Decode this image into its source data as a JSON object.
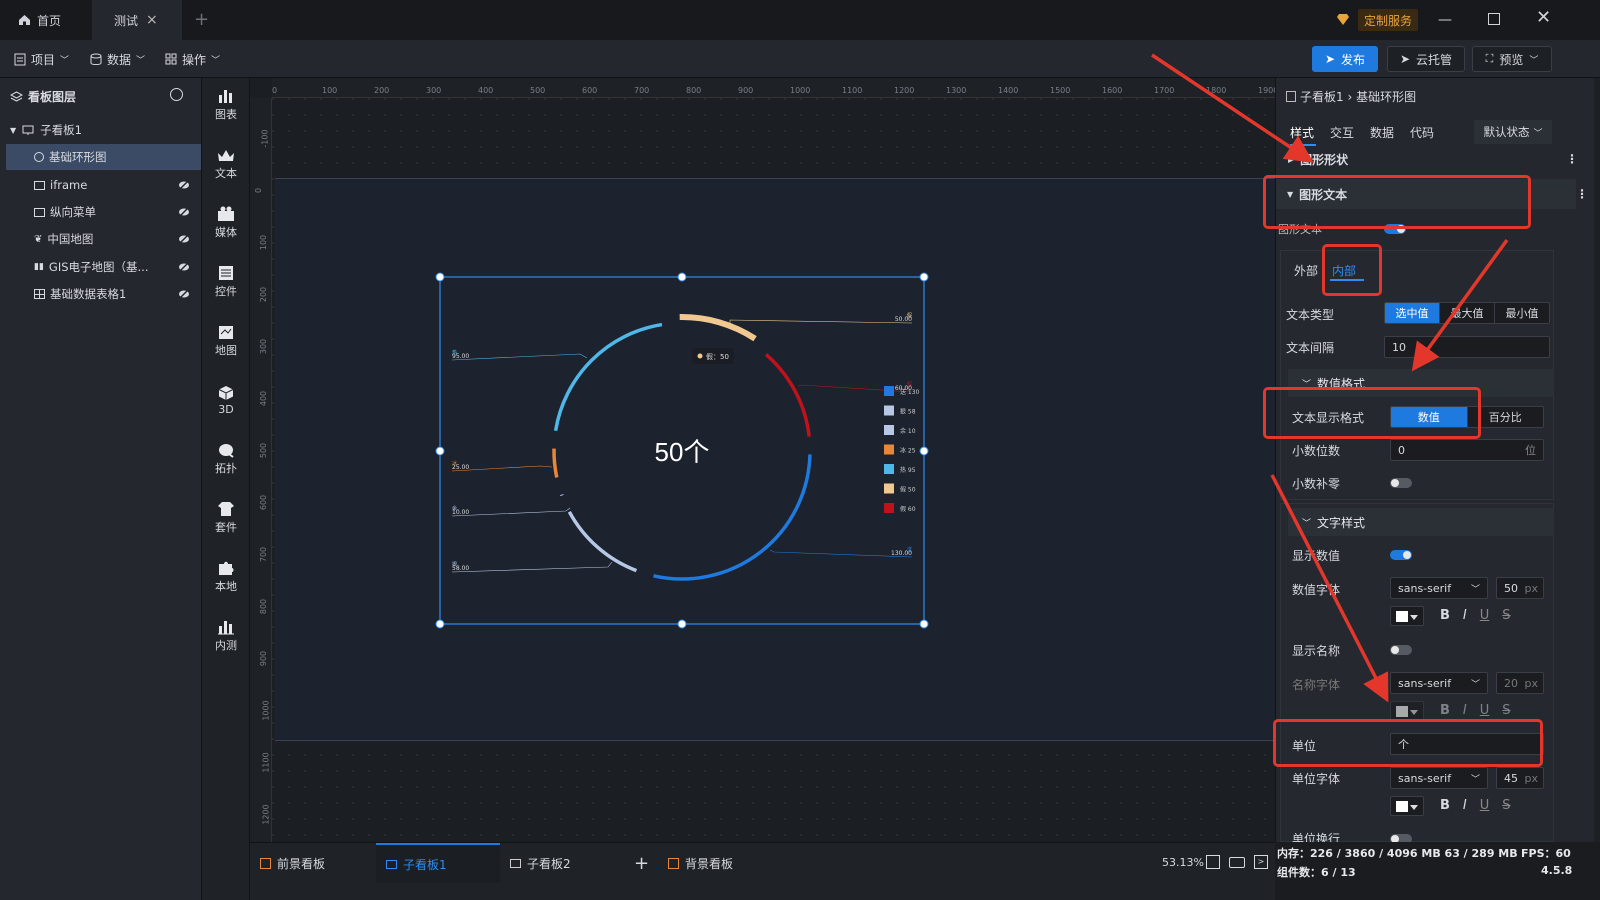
{
  "titlebar": {
    "tabs": [
      {
        "label": "首页"
      },
      {
        "label": "测试"
      }
    ],
    "service_label": "定制服务"
  },
  "menubar": {
    "items": [
      {
        "label": "项目"
      },
      {
        "label": "数据"
      },
      {
        "label": "操作"
      }
    ],
    "publish_label": "发布",
    "cloud_label": "云托管",
    "preview_label": "预览"
  },
  "layers": {
    "title": "看板图层",
    "root": "子看板1",
    "items": [
      {
        "label": "基础环形图",
        "icon": "ring-icon"
      },
      {
        "label": "iframe",
        "icon": "frame-icon"
      },
      {
        "label": "纵向菜单",
        "icon": "menu-icon"
      },
      {
        "label": "中国地图",
        "icon": "map-icon"
      },
      {
        "label": "GIS电子地图（基...",
        "icon": "gis-icon"
      },
      {
        "label": "基础数据表格1",
        "icon": "table-icon"
      }
    ]
  },
  "toolbox": {
    "items": [
      {
        "label": "图表",
        "icon": "chart-icon"
      },
      {
        "label": "文本",
        "icon": "text-icon"
      },
      {
        "label": "媒体",
        "icon": "media-icon"
      },
      {
        "label": "控件",
        "icon": "control-icon"
      },
      {
        "label": "地图",
        "icon": "map-icon"
      },
      {
        "label": "3D",
        "icon": "cube-icon"
      },
      {
        "label": "拓扑",
        "icon": "topology-icon"
      },
      {
        "label": "套件",
        "icon": "kit-icon"
      },
      {
        "label": "本地",
        "icon": "puzzle-icon"
      },
      {
        "label": "内测",
        "icon": "beta-icon"
      }
    ]
  },
  "ruler": {
    "h_ticks": [
      "0",
      "100",
      "200",
      "300",
      "400",
      "500",
      "600",
      "700",
      "800",
      "900",
      "1000",
      "1100",
      "1200",
      "1300",
      "1400",
      "1500",
      "1600",
      "1700",
      "1800",
      "1900"
    ],
    "v_ticks": [
      "-100",
      "0",
      "100",
      "200",
      "300",
      "400",
      "500",
      "600",
      "700",
      "800",
      "900",
      "1000",
      "1100",
      "1200"
    ]
  },
  "widget": {
    "center_label": "50个",
    "tooltip": "假：50",
    "left_labels": [
      {
        "name": "热",
        "value": "95.00",
        "color": "#4fb8e8"
      },
      {
        "name": "冰",
        "value": "25.00",
        "color": "#e8863a"
      },
      {
        "name": "余",
        "value": "10.00",
        "color": "#b6c8e6"
      },
      {
        "name": "狠",
        "value": "58.00",
        "color": "#b6c8e6"
      }
    ],
    "right_labels": [
      {
        "name": "假",
        "value": "50.00",
        "color": "#f0c890"
      },
      {
        "name": "假",
        "value": "60.00",
        "color": "#c0121b"
      },
      {
        "name": "送",
        "value": "130.00",
        "color": "#1f7ae0"
      }
    ],
    "legend": [
      {
        "name": "送",
        "value": "130",
        "color": "#1f7ae0"
      },
      {
        "name": "狠",
        "value": "58",
        "color": "#b6c8e6"
      },
      {
        "name": "余",
        "value": "10",
        "color": "#b6c8e6"
      },
      {
        "name": "冰",
        "value": "25",
        "color": "#e8863a"
      },
      {
        "name": "热",
        "value": "95",
        "color": "#4fb8e8"
      },
      {
        "name": "假",
        "value": "50",
        "color": "#f0c890"
      },
      {
        "name": "假",
        "value": "60",
        "color": "#c0121b"
      }
    ]
  },
  "props": {
    "breadcrumb": "子看板1 › 基础环形图",
    "tabs": [
      {
        "label": "样式"
      },
      {
        "label": "交互"
      },
      {
        "label": "数据"
      },
      {
        "label": "代码"
      }
    ],
    "state_select": "默认状态",
    "section_shape": "图形形状",
    "section_text": "图形文本",
    "text_toggle_label": "图形文本",
    "position_tabs": [
      {
        "label": "外部"
      },
      {
        "label": "内部"
      }
    ],
    "text_type_label": "文本类型",
    "text_type_options": [
      "选中值",
      "最大值",
      "最小值"
    ],
    "text_gap_label": "文本间隔",
    "text_gap_value": "10",
    "number_format_section": "数值格式",
    "display_format_label": "文本显示格式",
    "display_format_options": [
      "数值",
      "百分比"
    ],
    "decimals_label": "小数位数",
    "decimals_value": "0",
    "decimals_unit": "位",
    "pad_zero_label": "小数补零",
    "text_style_section": "文字样式",
    "show_value_label": "显示数值",
    "value_font_label": "数值字体",
    "value_font": "sans-serif",
    "value_size": "50",
    "show_name_label": "显示名称",
    "name_font_label": "名称字体",
    "name_font": "sans-serif",
    "name_size": "20",
    "unit_label": "单位",
    "unit_value": "个",
    "unit_font_label": "单位字体",
    "unit_font": "sans-serif",
    "unit_size": "45",
    "unit_wrap_label": "单位换行",
    "px": "px"
  },
  "bottom": {
    "tabs": [
      {
        "label": "前景看板"
      },
      {
        "label": "子看板1"
      },
      {
        "label": "子看板2"
      },
      {
        "label": "背景看板"
      }
    ],
    "add_label": "+",
    "zoom": "53.13%"
  },
  "status": {
    "memory": "内存：226 / 3860 / 4096 MB  63 / 289 MB",
    "fps": "FPS：60",
    "components": "组件数：6 / 13",
    "version": "4.5.8"
  }
}
